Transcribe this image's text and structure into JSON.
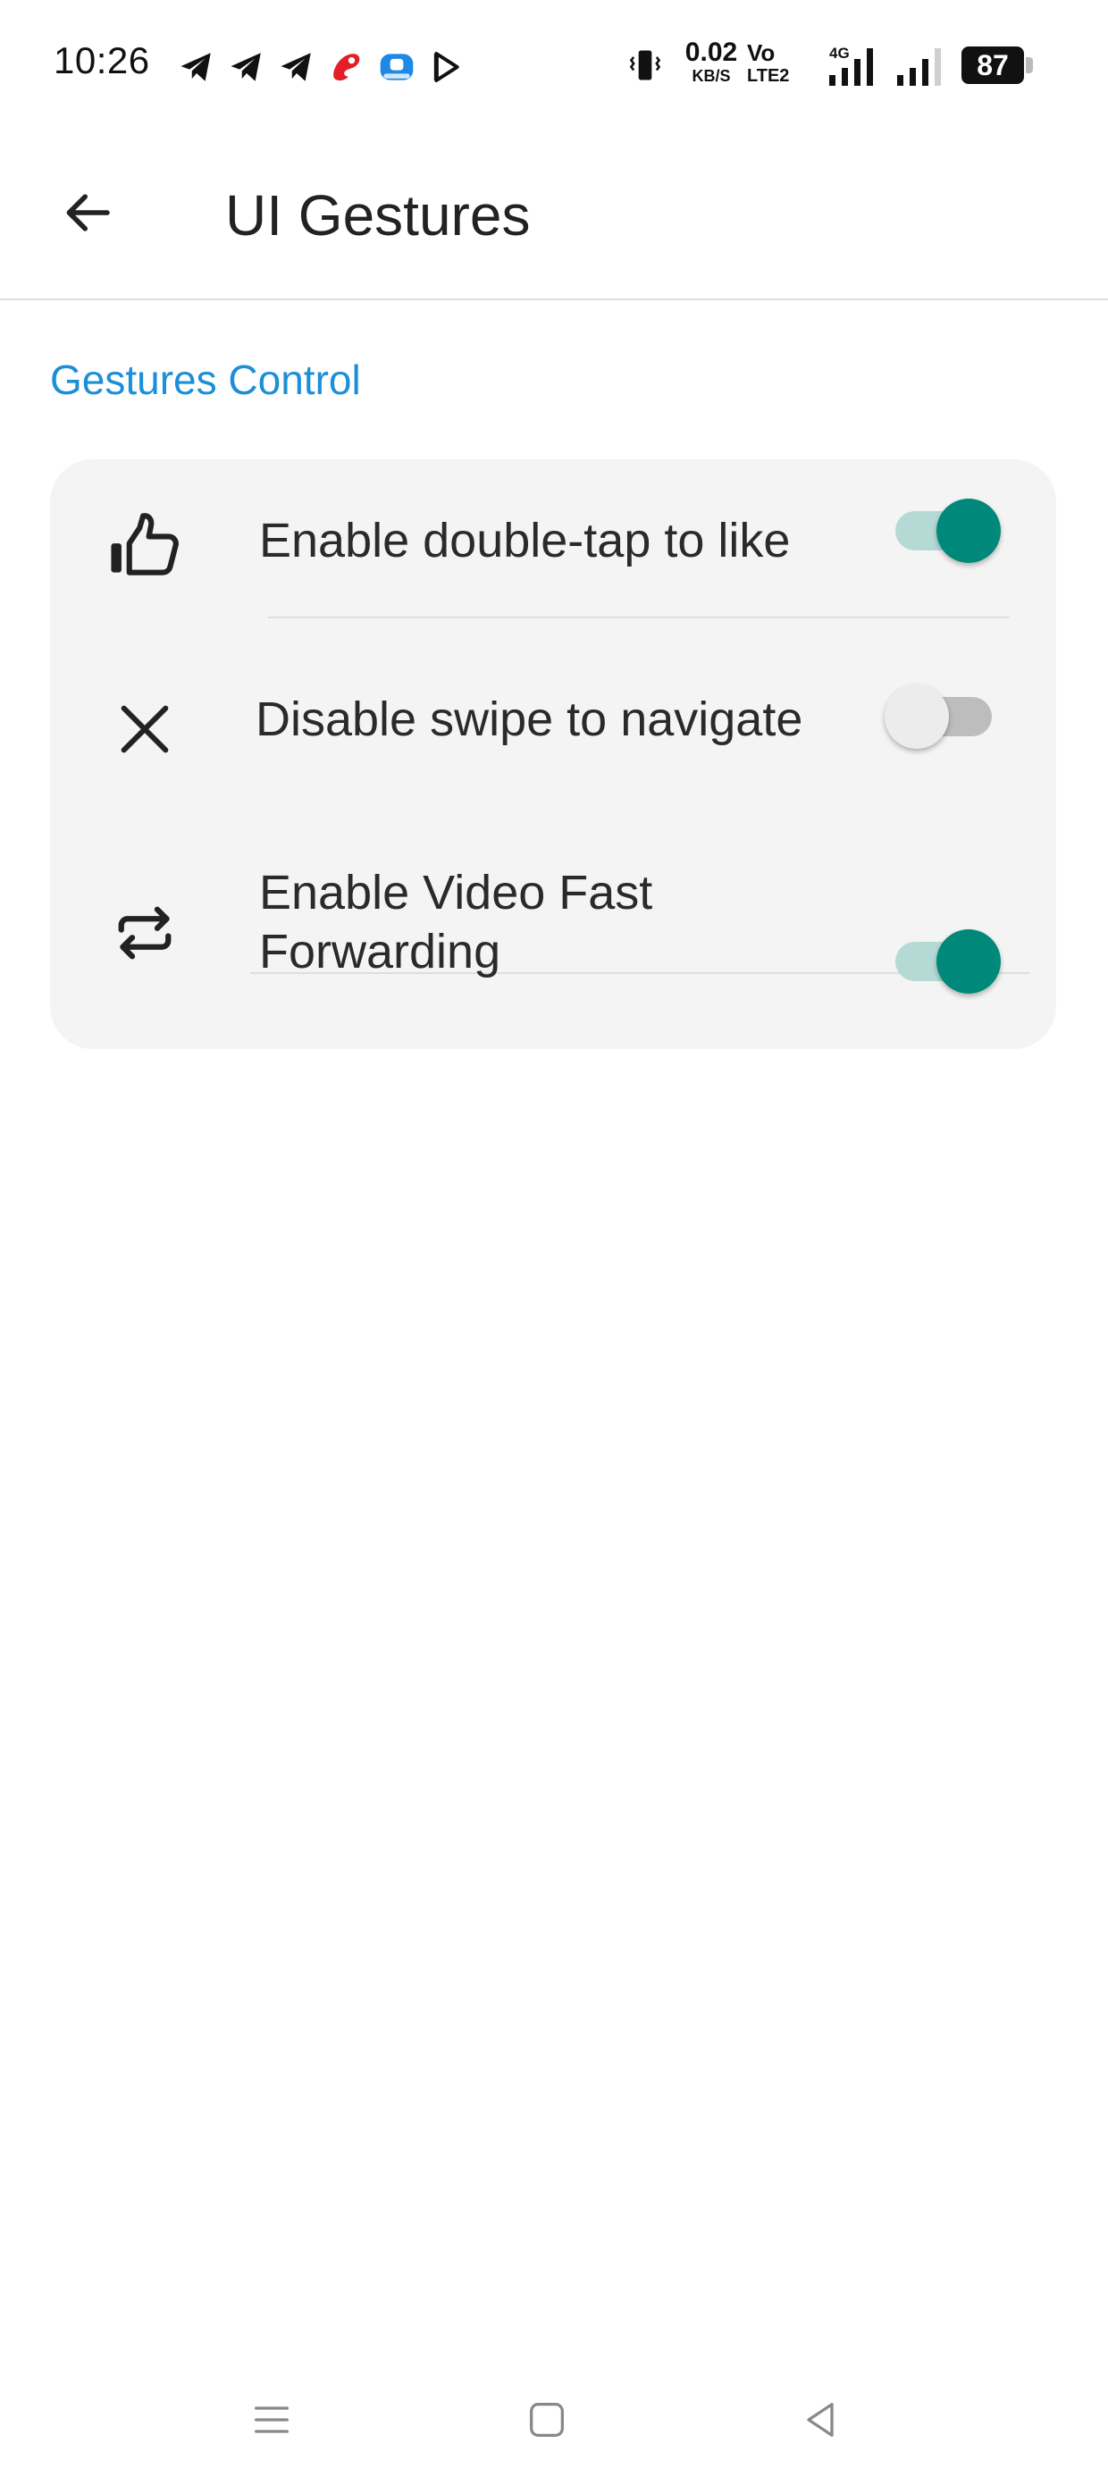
{
  "status_bar": {
    "time": "10:26",
    "net_speed_value": "0.02",
    "net_speed_unit": "KB/S",
    "volte_top": "Vo",
    "volte_bottom": "LTE2",
    "network_type": "4G",
    "battery": "87",
    "notification_icons": [
      "telegram-icon",
      "telegram-icon",
      "telegram-icon",
      "airtel-icon",
      "app-badge-icon",
      "playstore-icon"
    ]
  },
  "app_bar": {
    "title": "UI Gestures",
    "back_icon": "arrow-left-icon"
  },
  "section": {
    "title": "Gestures Control"
  },
  "settings": [
    {
      "label": "Enable double-tap to like",
      "icon": "thumbs-up-icon",
      "enabled": true
    },
    {
      "label": "Disable swipe to navigate",
      "icon": "close-icon",
      "enabled": false
    },
    {
      "label": "Enable Video Fast Forwarding",
      "icon": "repeat-icon",
      "enabled": true
    }
  ],
  "colors": {
    "accent": "#1b8fd8",
    "toggle_on_thumb": "#00897b",
    "toggle_on_track": "#b5dad6",
    "toggle_off_thumb": "#ececec",
    "toggle_off_track": "#bdbdbd",
    "card_background": "#f4f4f4"
  },
  "nav_bar": {
    "buttons": [
      "menu-icon",
      "home-icon",
      "back-icon"
    ]
  }
}
